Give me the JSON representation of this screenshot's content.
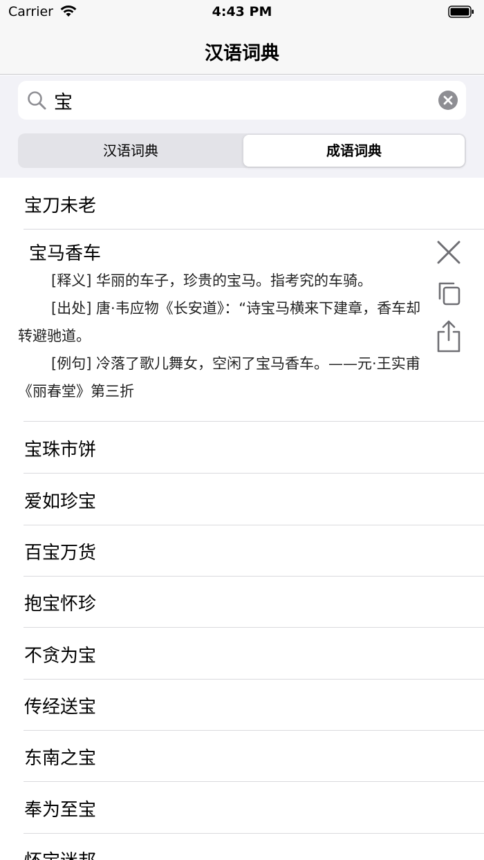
{
  "status_bar": {
    "carrier": "Carrier",
    "time": "4:43 PM"
  },
  "nav": {
    "title": "汉语词典"
  },
  "search": {
    "value": "宝"
  },
  "segments": [
    {
      "label": "汉语词典",
      "selected": false
    },
    {
      "label": "成语词典",
      "selected": true
    }
  ],
  "list": {
    "first_item": "宝刀未老",
    "expanded": {
      "title": "宝马香车",
      "definition": "[释义] 华丽的车子，珍贵的宝马。指考究的车骑。",
      "source": "[出处] 唐·韦应物《长安道》：“诗宝马横来下建章，香车却转避驰道。",
      "example": "[例句] 冷落了歌儿舞女，空闲了宝马香车。——元·王实甫《丽春堂》第三折"
    },
    "items": [
      "宝珠市饼",
      "爱如珍宝",
      "百宝万货",
      "抱宝怀珍",
      "不贪为宝",
      "传经送宝",
      "东南之宝",
      "奉为至宝",
      "怀宝迷邦"
    ]
  },
  "colors": {
    "icon_gray": "#6e6e73",
    "separator": "#d9d9dd",
    "background": "#f2f2f7"
  }
}
